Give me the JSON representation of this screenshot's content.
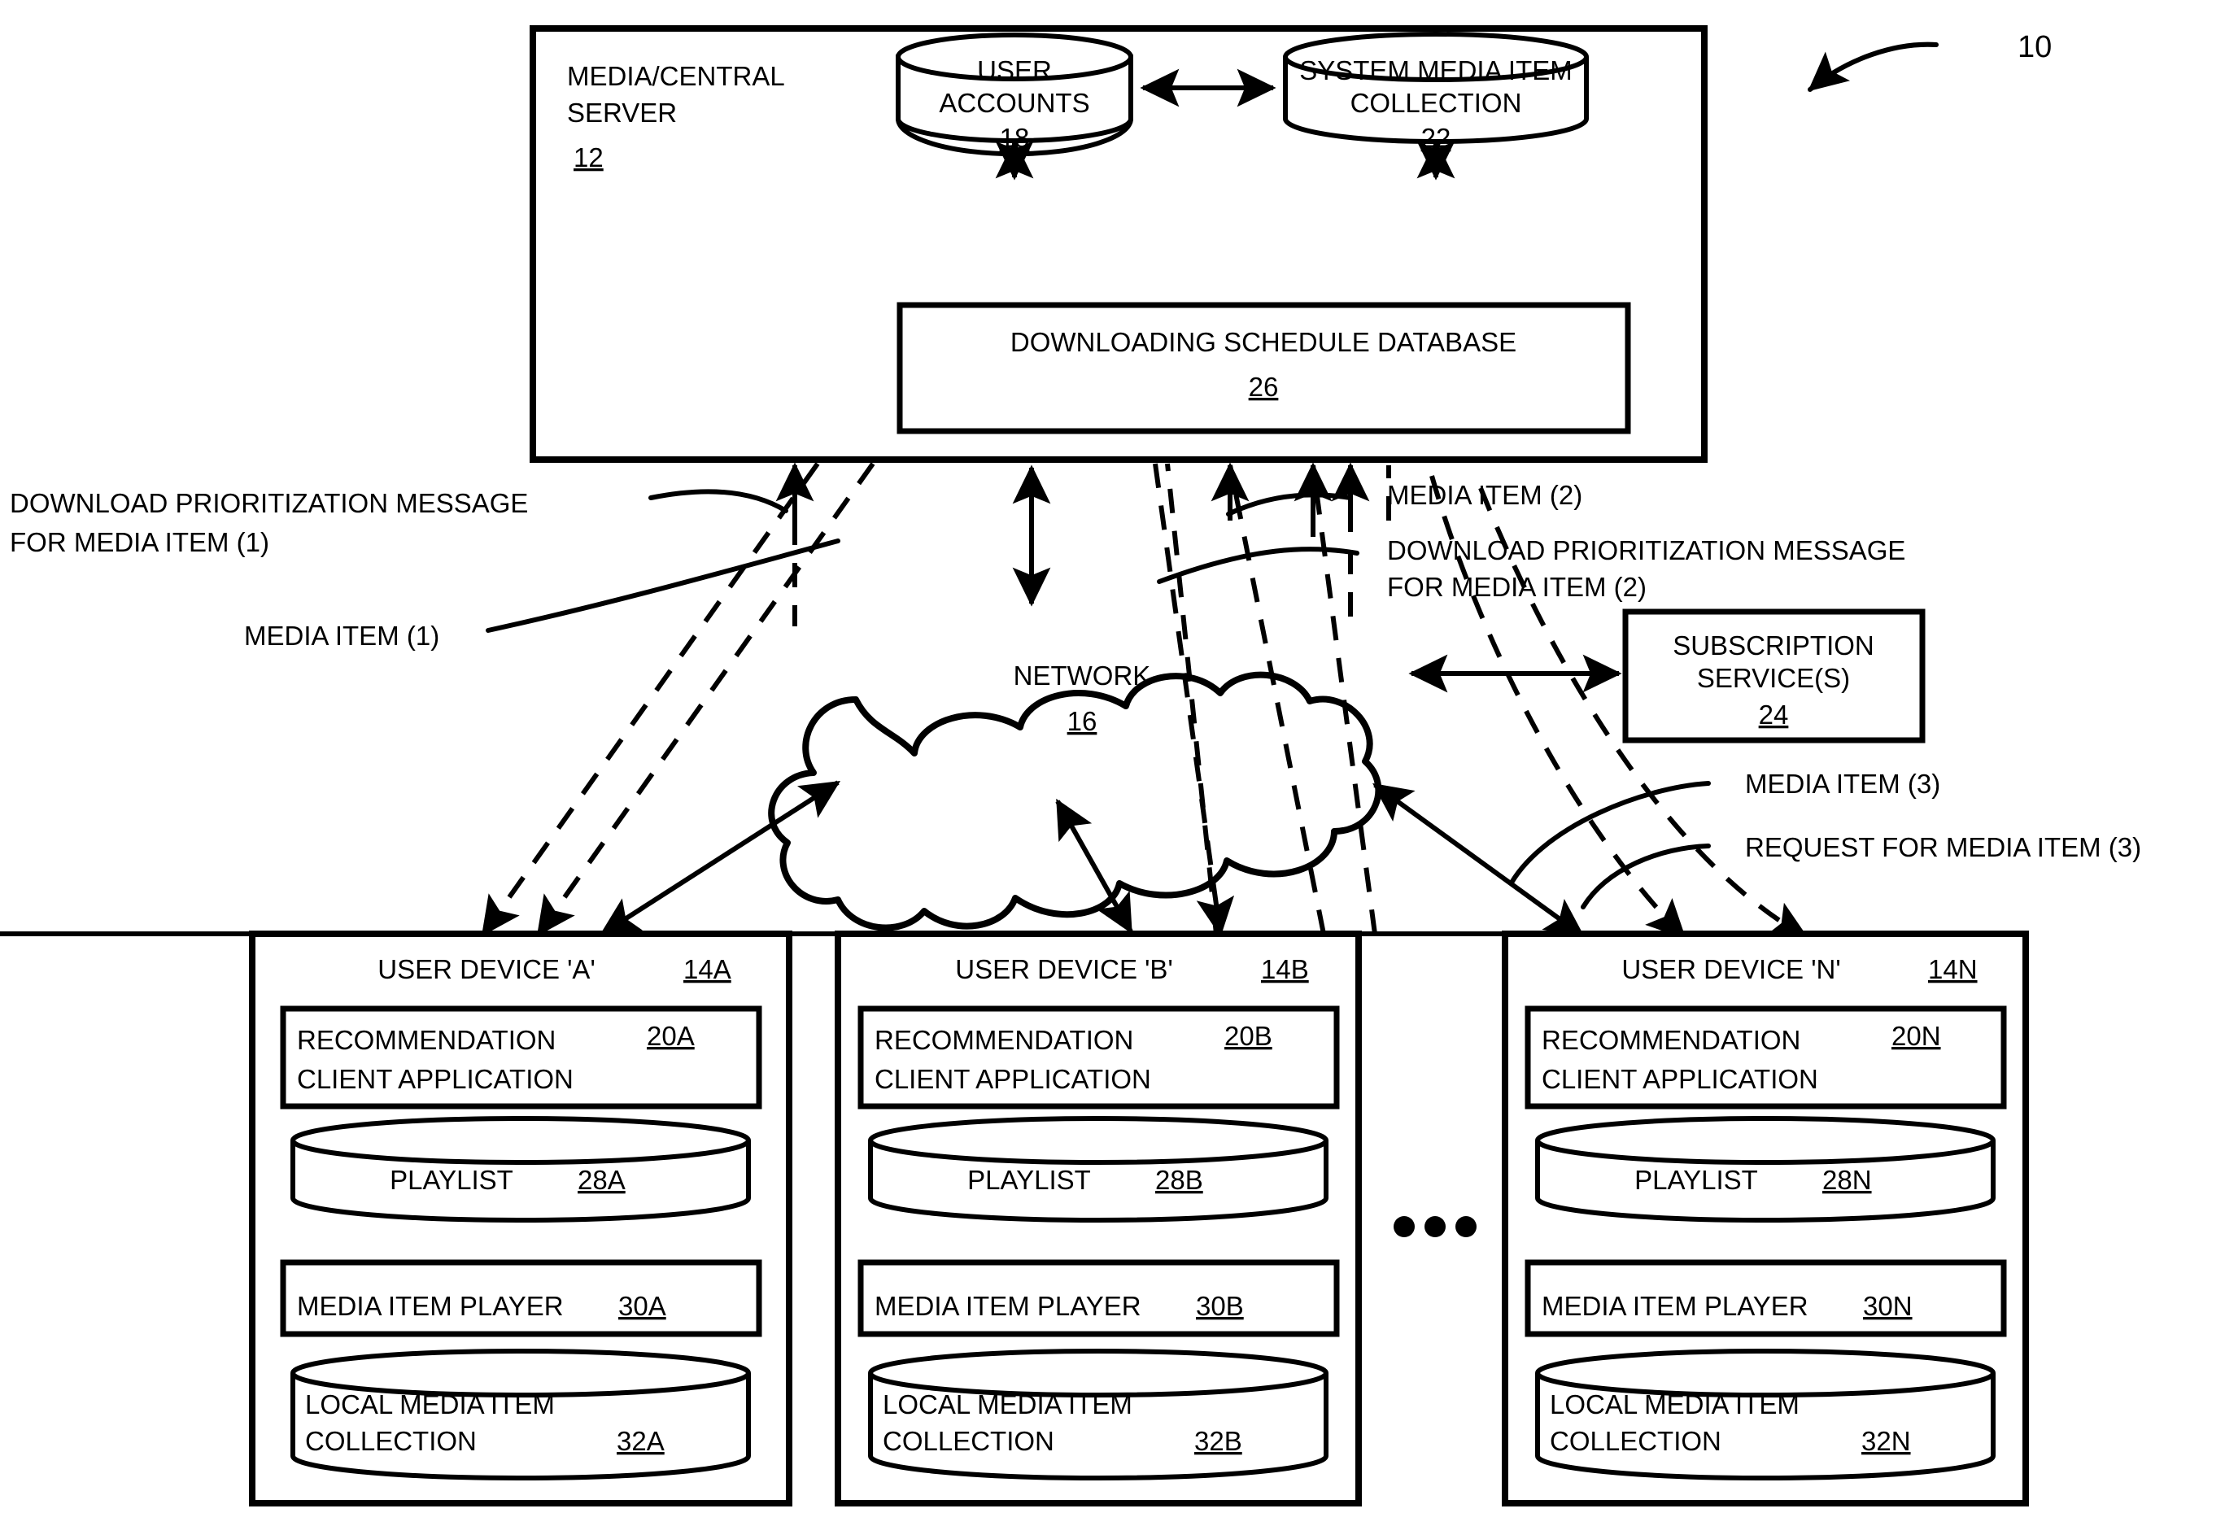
{
  "figure": {
    "figure_ref": "10",
    "server": {
      "title_line1": "MEDIA/CENTRAL",
      "title_line2": "SERVER",
      "ref": "12",
      "user_accounts": {
        "line1": "USER",
        "line2": "ACCOUNTS",
        "ref": "18"
      },
      "system_media": {
        "line1": "SYSTEM MEDIA ITEM",
        "line2": "COLLECTION",
        "ref": "22"
      },
      "schedule_db": {
        "label": "DOWNLOADING SCHEDULE DATABASE",
        "ref": "26"
      }
    },
    "network": {
      "label": "NETWORK",
      "ref": "16"
    },
    "subscription": {
      "line1": "SUBSCRIPTION",
      "line2": "SERVICE(S)",
      "ref": "24"
    },
    "annotations": {
      "dl_prio_1_line1": "DOWNLOAD PRIORITIZATION MESSAGE",
      "dl_prio_1_line2": "FOR MEDIA ITEM (1)",
      "media_item_1": "MEDIA ITEM (1)",
      "media_item_2": "MEDIA ITEM (2)",
      "dl_prio_2_line1": "DOWNLOAD PRIORITIZATION MESSAGE",
      "dl_prio_2_line2": "FOR MEDIA ITEM (2)",
      "media_item_3": "MEDIA ITEM (3)",
      "request_media_item_3": "REQUEST FOR MEDIA ITEM (3)"
    },
    "ellipsis": "• • •",
    "devices": [
      {
        "title": "USER DEVICE 'A'",
        "ref": "14A",
        "rec_app_line1": "RECOMMENDATION",
        "rec_app_line2": "CLIENT APPLICATION",
        "rec_app_ref": "20A",
        "playlist": "PLAYLIST",
        "playlist_ref": "28A",
        "player": "MEDIA ITEM PLAYER",
        "player_ref": "30A",
        "local_line1": "LOCAL MEDIA ITEM",
        "local_line2": "COLLECTION",
        "local_ref": "32A"
      },
      {
        "title": "USER DEVICE 'B'",
        "ref": "14B",
        "rec_app_line1": "RECOMMENDATION",
        "rec_app_line2": "CLIENT APPLICATION",
        "rec_app_ref": "20B",
        "playlist": "PLAYLIST",
        "playlist_ref": "28B",
        "player": "MEDIA ITEM PLAYER",
        "player_ref": "30B",
        "local_line1": "LOCAL MEDIA ITEM",
        "local_line2": "COLLECTION",
        "local_ref": "32B"
      },
      {
        "title": "USER DEVICE 'N'",
        "ref": "14N",
        "rec_app_line1": "RECOMMENDATION",
        "rec_app_line2": "CLIENT APPLICATION",
        "rec_app_ref": "20N",
        "playlist": "PLAYLIST",
        "playlist_ref": "28N",
        "player": "MEDIA ITEM PLAYER",
        "player_ref": "30N",
        "local_line1": "LOCAL MEDIA ITEM",
        "local_line2": "COLLECTION",
        "local_ref": "32N"
      }
    ],
    "colors": {
      "ink": "#000000",
      "paper": "#ffffff"
    }
  }
}
